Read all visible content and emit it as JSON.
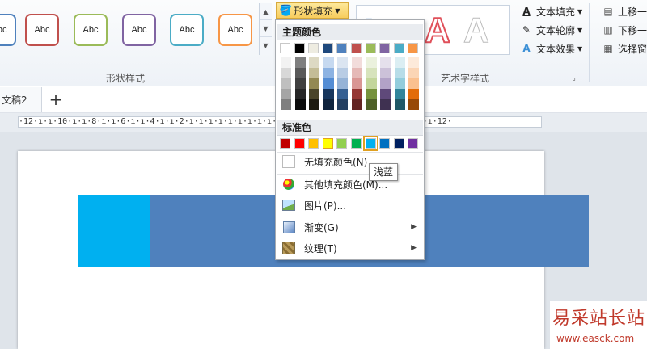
{
  "ribbon": {
    "shape_styles": [
      {
        "label": "Abc",
        "color": "#4f81bd"
      },
      {
        "label": "Abc",
        "color": "#c0504d"
      },
      {
        "label": "Abc",
        "color": "#9bbb59"
      },
      {
        "label": "Abc",
        "color": "#8064a2"
      },
      {
        "label": "Abc",
        "color": "#4bacc6"
      },
      {
        "label": "Abc",
        "color": "#f79646"
      }
    ],
    "shape_styles_group": "形状样式",
    "shape_fill_button": "形状填充",
    "wordart_letters": [
      "A",
      "A",
      "A"
    ],
    "wordart_group": "艺术字样式",
    "text_fill": "文本填充",
    "text_outline": "文本轮廓",
    "text_effects": "文本效果",
    "bring_forward": "上移一",
    "send_backward": "下移一",
    "selection_pane": "选择窗"
  },
  "tabs": {
    "doc_tab": "文稿2",
    "add_tab": "+"
  },
  "ruler": {
    "text": "·12·ı·ı·10·ı·ı·8·ı·ı·6·ı·ı·4·ı·ı·2·ı·ı·ı·ı·ı·ı·ı·ı·ı·ı·2·ı·ı·4·ı·ı·6·ı·ı·8·ı·ı·10·ı·ı·12·"
  },
  "dropdown": {
    "theme_colors_label": "主题颜色",
    "theme_top": [
      "#ffffff",
      "#000000",
      "#eeece1",
      "#1f497d",
      "#4f81bd",
      "#c0504d",
      "#9bbb59",
      "#8064a2",
      "#4bacc6",
      "#f79646"
    ],
    "theme_shades": [
      [
        "#f2f2f2",
        "#d8d8d8",
        "#bfbfbf",
        "#a5a5a5",
        "#7f7f7f"
      ],
      [
        "#7f7f7f",
        "#595959",
        "#3f3f3f",
        "#262626",
        "#0c0c0c"
      ],
      [
        "#ddd9c3",
        "#c4bd97",
        "#938953",
        "#494429",
        "#1d1b10"
      ],
      [
        "#c6d9f0",
        "#8db3e2",
        "#548dd4",
        "#17365d",
        "#0f243e"
      ],
      [
        "#dbe5f1",
        "#b8cce4",
        "#95b3d7",
        "#366092",
        "#244061"
      ],
      [
        "#f2dcdb",
        "#e5b9b7",
        "#d99694",
        "#953734",
        "#632423"
      ],
      [
        "#ebf1dd",
        "#d7e3bc",
        "#c3d69b",
        "#76923c",
        "#4f6128"
      ],
      [
        "#e5e0ec",
        "#ccc1d9",
        "#b2a2c7",
        "#5f497a",
        "#3f3151"
      ],
      [
        "#dbeef3",
        "#b7dde8",
        "#92cddc",
        "#31859b",
        "#205867"
      ],
      [
        "#fdeada",
        "#fbd5b5",
        "#fac08f",
        "#e36c09",
        "#974806"
      ]
    ],
    "standard_colors_label": "标准色",
    "standard_colors": [
      "#c00000",
      "#ff0000",
      "#ffc000",
      "#ffff00",
      "#92d050",
      "#00b050",
      "#00b0f0",
      "#0070c0",
      "#002060",
      "#7030a0"
    ],
    "no_fill": "无填充颜色(N)",
    "more_fill": "其他填充颜色(M)...",
    "picture": "图片(P)...",
    "gradient": "渐变(G)",
    "texture": "纹理(T)"
  },
  "tooltip": "浅蓝",
  "watermark": {
    "title": "易采站长站",
    "url": "www.easck.com"
  },
  "colors": {
    "main_rect": "#4f81bd",
    "cyan_rect": "#00b0f0"
  }
}
